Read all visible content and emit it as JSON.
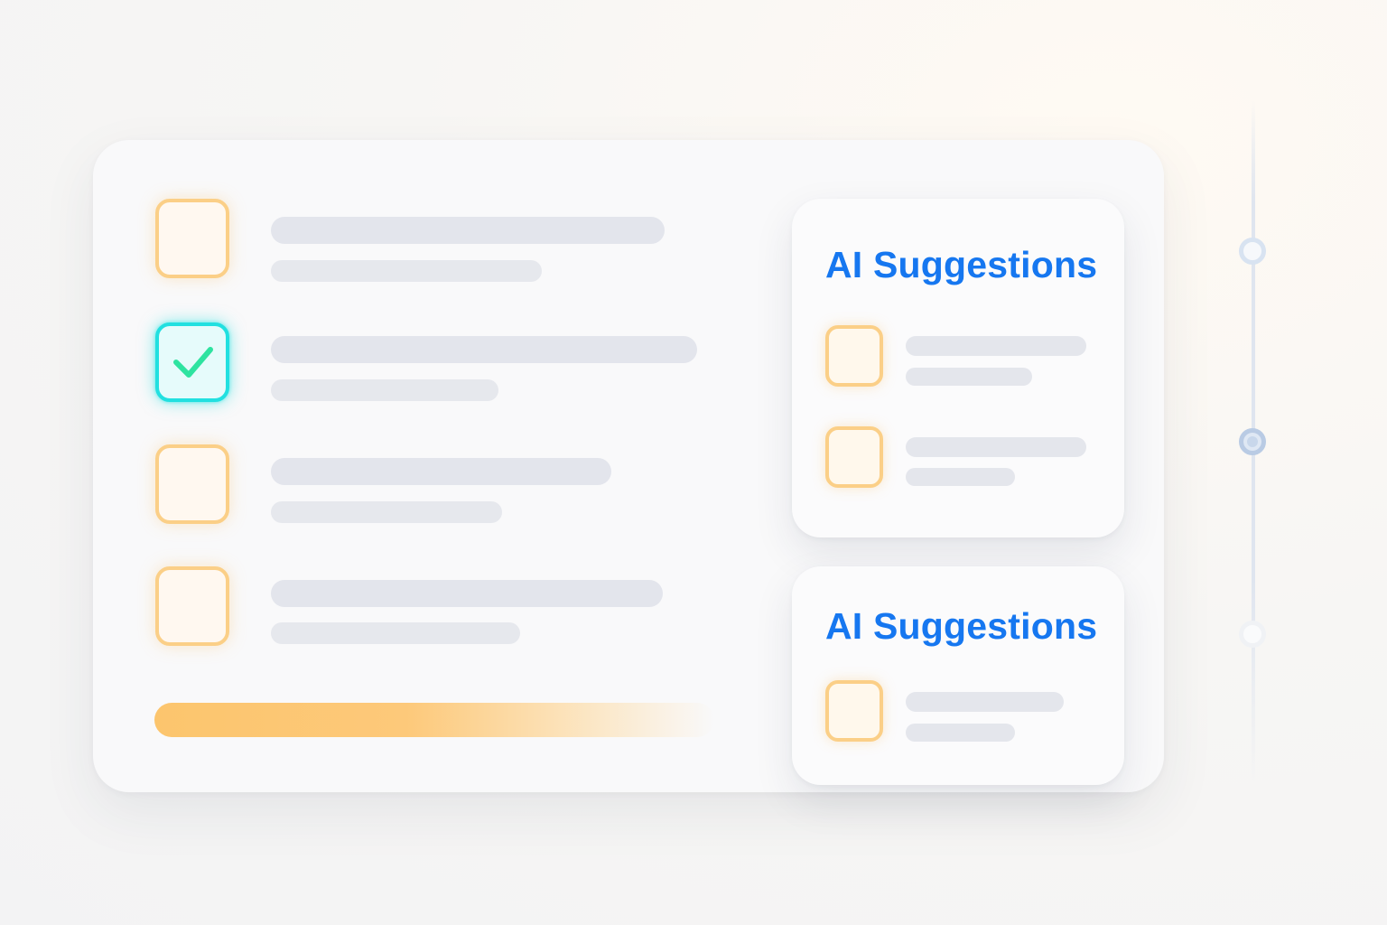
{
  "app": {
    "background_color": "#f5f5f6",
    "accent_color": "#1677f0",
    "pending_color": "#fbcf87",
    "complete_color": "#21e0e0",
    "check_color": "#2ee3a0"
  },
  "tasks": [
    {
      "checked": false
    },
    {
      "checked": true
    },
    {
      "checked": false
    },
    {
      "checked": false
    }
  ],
  "progress": {
    "fill_color": "#fcc56d"
  },
  "suggestion_panels": [
    {
      "title": "AI Suggestions",
      "items": [
        {
          "checked": false
        },
        {
          "checked": false
        }
      ]
    },
    {
      "title": "AI Suggestions",
      "items": [
        {
          "checked": false
        }
      ]
    }
  ],
  "icons": {
    "checkmark": "checkmark-icon"
  }
}
